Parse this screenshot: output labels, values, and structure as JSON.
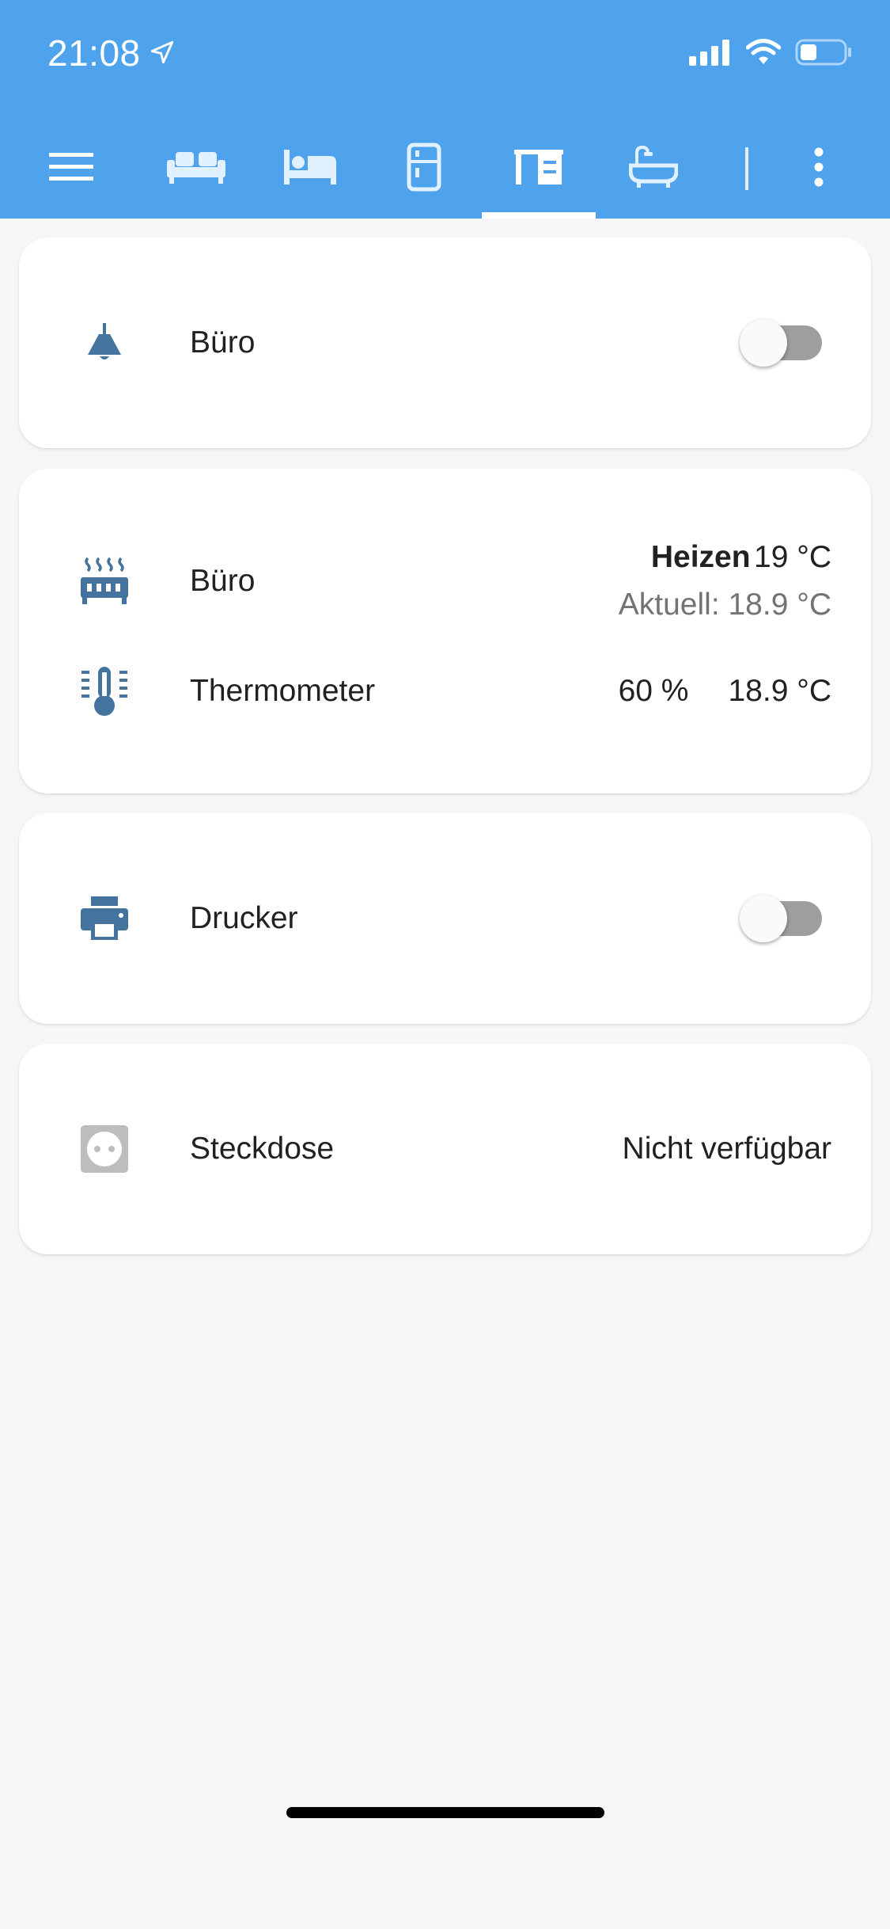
{
  "status_bar": {
    "time": "21:08",
    "icons": [
      "location-arrow-icon",
      "signal-icon",
      "wifi-icon",
      "battery-icon"
    ]
  },
  "toolbar": {
    "items": [
      {
        "name": "menu-icon",
        "active": false
      },
      {
        "name": "sofa-icon",
        "active": false
      },
      {
        "name": "bed-icon",
        "active": false
      },
      {
        "name": "fridge-icon",
        "active": false
      },
      {
        "name": "desk-icon",
        "active": true
      },
      {
        "name": "bathtub-icon",
        "active": false
      },
      {
        "name": "divider",
        "active": false
      },
      {
        "name": "more-vertical-icon",
        "active": false
      }
    ]
  },
  "colors": {
    "header": "#4fa3ec",
    "entity_icon": "#44739e",
    "unavailable_icon": "#bdbdbd",
    "toggle_off_track": "#9e9e9e",
    "background": "#f6f6f6"
  },
  "cards": {
    "light": {
      "icon": "ceiling-lamp-icon",
      "name": "Büro",
      "toggle_on": false
    },
    "climate": {
      "heater": {
        "icon": "radiator-icon",
        "name": "Büro",
        "mode": "Heizen",
        "target": "19 °C",
        "current": "Aktuell: 18.9 °C"
      },
      "thermometer": {
        "icon": "thermometer-icon",
        "name": "Thermometer",
        "humidity": "60 %",
        "temperature": "18.9 °C"
      }
    },
    "printer": {
      "icon": "printer-icon",
      "name": "Drucker",
      "toggle_on": false
    },
    "socket": {
      "icon": "power-socket-icon",
      "name": "Steckdose",
      "state": "Nicht verfügbar"
    }
  }
}
